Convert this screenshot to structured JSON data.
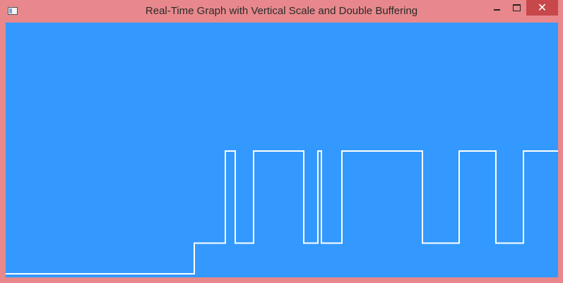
{
  "window": {
    "title": "Real-Time Graph with Vertical Scale and Double Buffering",
    "close_glyph": "✕",
    "titlebar_color": "#e8888c",
    "close_button_color": "#c7474a"
  },
  "chart_data": {
    "type": "line",
    "step": true,
    "title": "",
    "xlabel": "",
    "ylabel": "",
    "background": "#3399ff",
    "line_color": "#ffffff",
    "grid": false,
    "series": [
      {
        "points": [
          [
            0,
            0
          ],
          [
            267,
            0
          ],
          [
            267,
            1
          ],
          [
            311,
            1
          ],
          [
            311,
            4
          ],
          [
            325,
            4
          ],
          [
            325,
            1
          ],
          [
            351,
            1
          ],
          [
            351,
            4
          ],
          [
            422,
            4
          ],
          [
            422,
            1
          ],
          [
            442,
            1
          ],
          [
            442,
            4
          ],
          [
            447,
            4
          ],
          [
            447,
            1
          ],
          [
            476,
            1
          ],
          [
            476,
            4
          ],
          [
            590,
            4
          ],
          [
            590,
            1
          ],
          [
            642,
            1
          ],
          [
            642,
            4
          ],
          [
            694,
            4
          ],
          [
            694,
            1
          ],
          [
            733,
            1
          ],
          [
            733,
            4
          ],
          [
            782,
            4
          ]
        ]
      }
    ],
    "xlim": [
      0,
      782
    ],
    "ylim": [
      0,
      4.7
    ]
  }
}
